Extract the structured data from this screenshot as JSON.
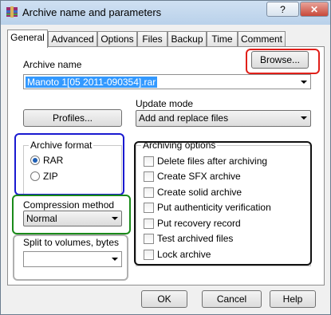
{
  "window": {
    "title": "Archive name and parameters",
    "help_label": "?",
    "close_label": "✕"
  },
  "tabs": [
    "General",
    "Advanced",
    "Options",
    "Files",
    "Backup",
    "Time",
    "Comment"
  ],
  "general": {
    "archive_name_label": "Archive name",
    "browse_label": "Browse...",
    "archive_name_value": "Manoto 1[05        2011-090354].rar",
    "update_mode_label": "Update mode",
    "profiles_label": "Profiles...",
    "update_mode_value": "Add and replace files",
    "archive_format": {
      "title": "Archive format",
      "options": [
        "RAR",
        "ZIP"
      ],
      "selected": "RAR"
    },
    "compression": {
      "label": "Compression method",
      "value": "Normal"
    },
    "split": {
      "label": "Split to volumes, bytes",
      "value": ""
    },
    "archiving_options": {
      "title": "Archiving options",
      "items": [
        "Delete files after archiving",
        "Create SFX archive",
        "Create solid archive",
        "Put authenticity verification",
        "Put recovery record",
        "Test archived files",
        "Lock archive"
      ]
    }
  },
  "footer": {
    "ok_label": "OK",
    "cancel_label": "Cancel",
    "help_label": "Help"
  },
  "annotation_colors": {
    "red": "#e0201a",
    "blue": "#1a1ad0",
    "green": "#1a8a1a",
    "gray": "#b0b0b0",
    "black": "#111111"
  }
}
